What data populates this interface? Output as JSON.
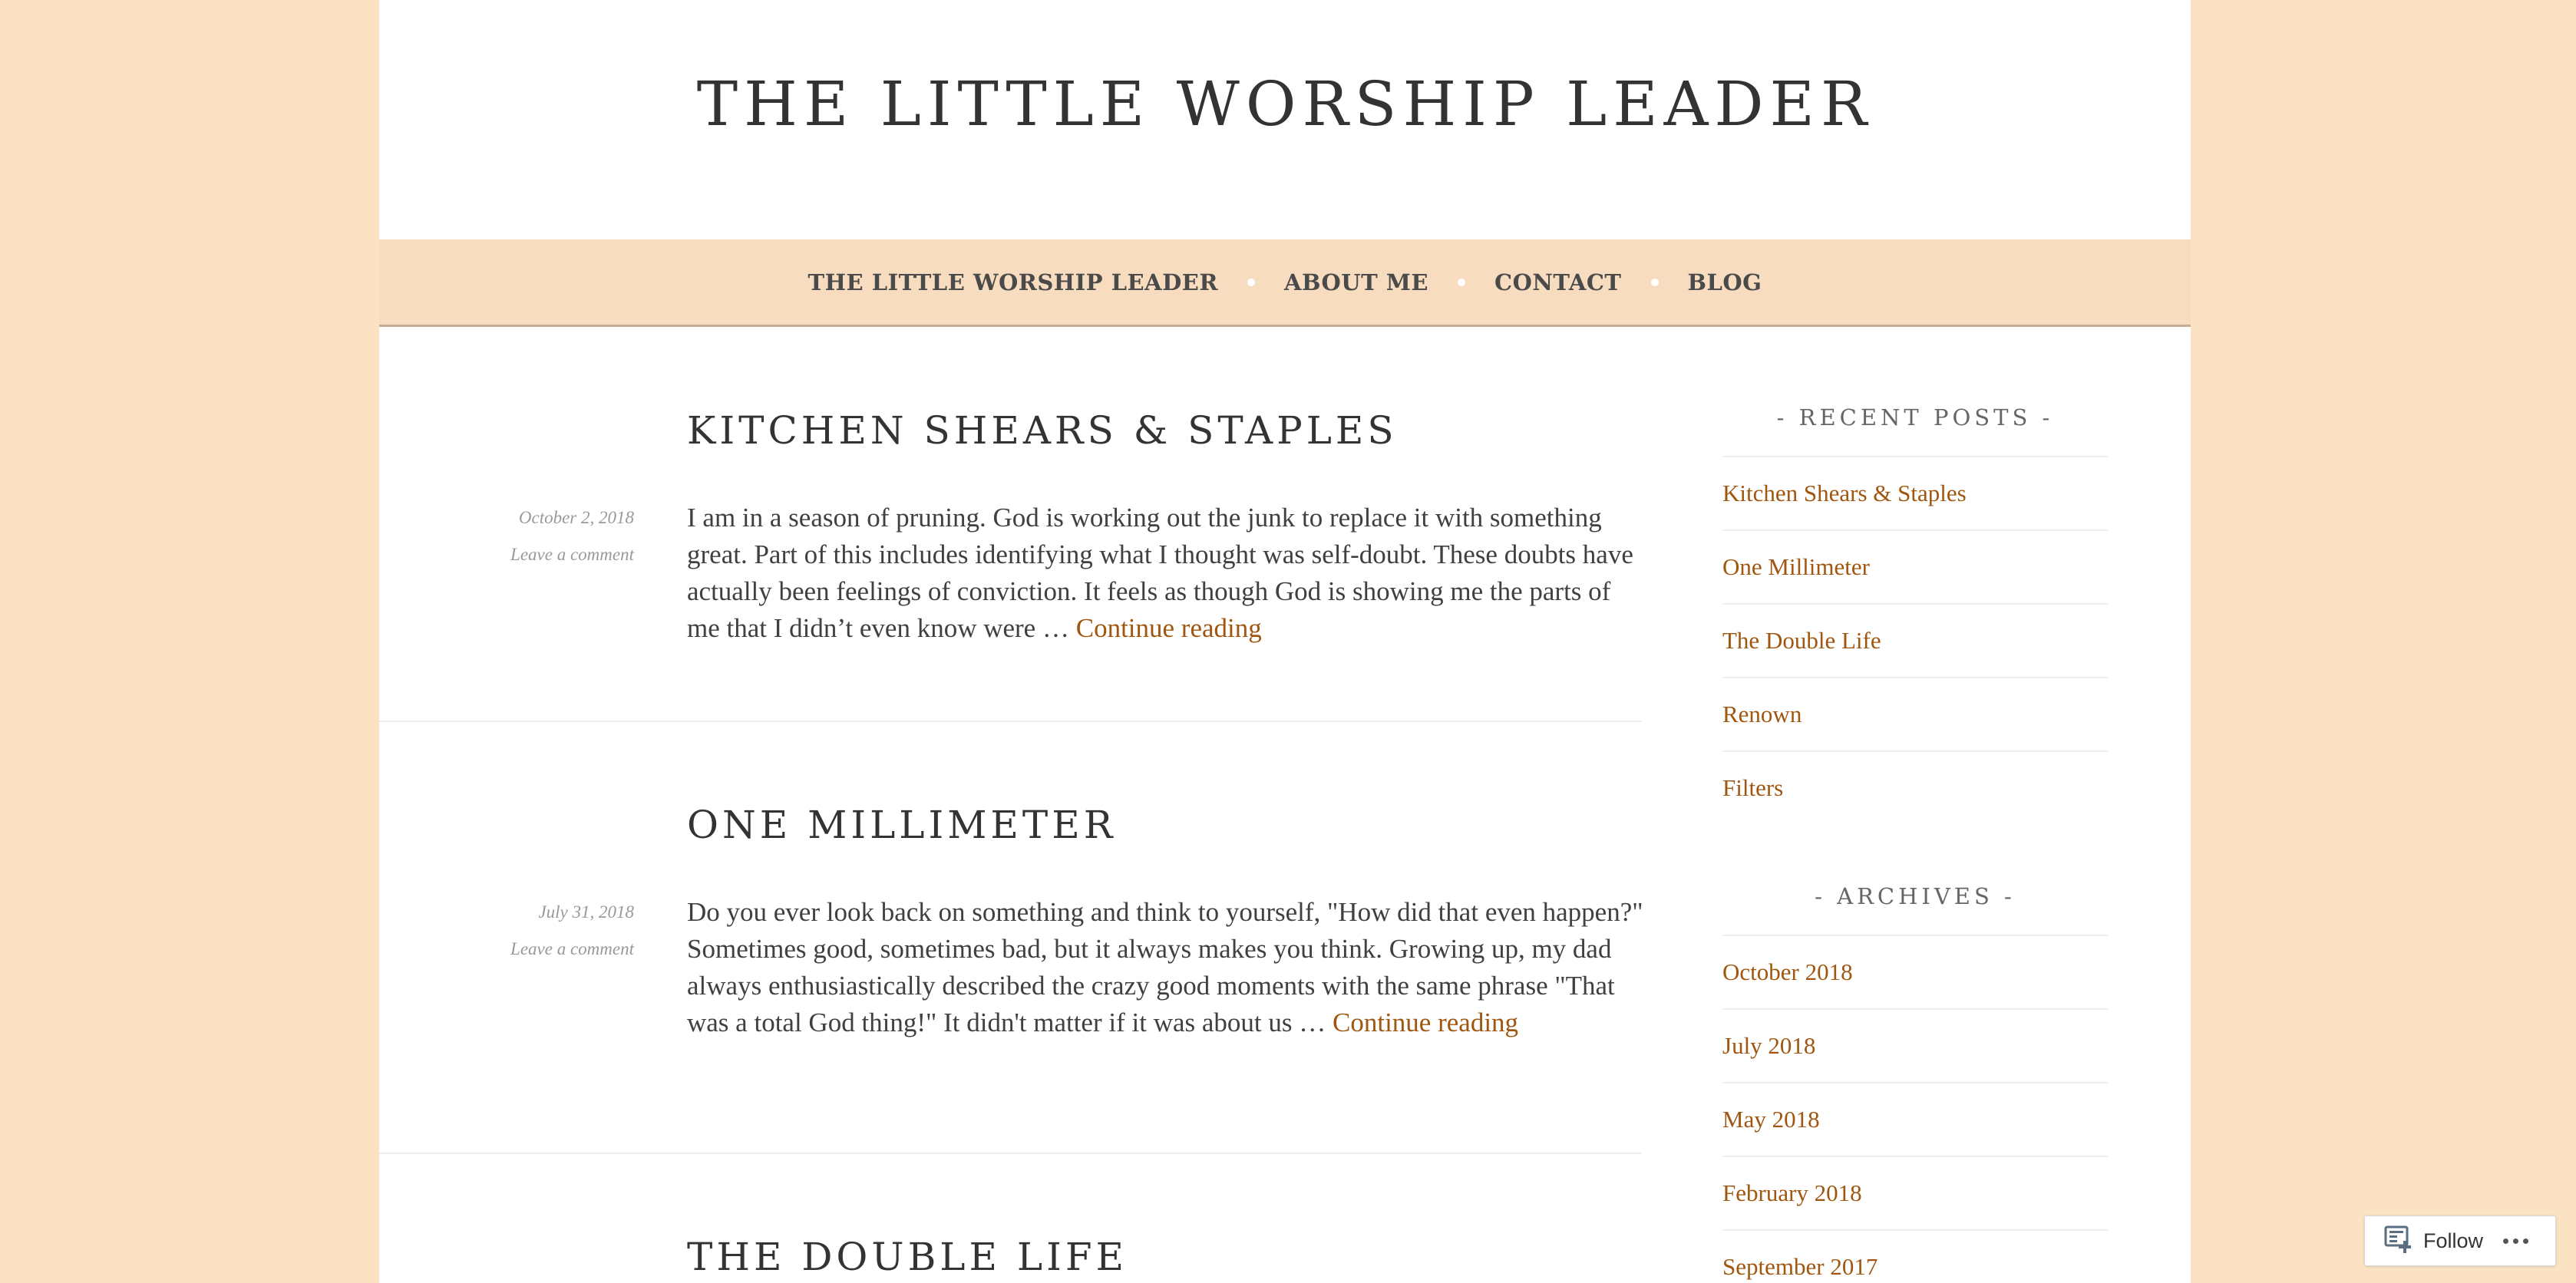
{
  "site": {
    "title": "THE LITTLE WORSHIP LEADER"
  },
  "nav": {
    "items": [
      {
        "label": "THE LITTLE WORSHIP LEADER"
      },
      {
        "label": "ABOUT ME"
      },
      {
        "label": "CONTACT"
      },
      {
        "label": "BLOG"
      }
    ]
  },
  "posts": [
    {
      "title": "KITCHEN SHEARS & STAPLES",
      "date": "October 2, 2018",
      "comment_link": "Leave a comment",
      "excerpt": "I am in a season of pruning. God is working out the junk to replace it with something great. Part of this includes identifying what I thought was self-doubt. These doubts have actually been feelings of conviction. It feels as though God is showing me the parts of me that I didn’t even know were …",
      "more_link": "Continue reading"
    },
    {
      "title": "ONE MILLIMETER",
      "date": "July 31, 2018",
      "comment_link": "Leave a comment",
      "excerpt": "Do you ever look back on something and think to yourself, \"How did that even happen?\" Sometimes good, sometimes bad, but it always makes you think. Growing up, my dad always enthusiastically described the crazy good moments with the same phrase \"That was a total God thing!\" It didn't matter if it was about us …",
      "more_link": "Continue reading"
    },
    {
      "title": "THE DOUBLE LIFE"
    }
  ],
  "sidebar": {
    "recent_posts": {
      "title": "- RECENT POSTS -",
      "items": [
        {
          "label": "Kitchen Shears & Staples"
        },
        {
          "label": "One Millimeter"
        },
        {
          "label": "The Double Life"
        },
        {
          "label": "Renown"
        },
        {
          "label": "Filters"
        }
      ]
    },
    "archives": {
      "title": "- ARCHIVES -",
      "items": [
        {
          "label": "October 2018"
        },
        {
          "label": "July 2018"
        },
        {
          "label": "May 2018"
        },
        {
          "label": "February 2018"
        },
        {
          "label": "September 2017"
        }
      ]
    }
  },
  "follow": {
    "label": "Follow",
    "icon": "reader-follow-icon",
    "more_icon": "ellipsis-icon"
  },
  "colors": {
    "background": "#fae2c3",
    "nav_background": "#f8dcc0",
    "link": "#a0560f",
    "text": "#404040",
    "title": "#333333"
  }
}
